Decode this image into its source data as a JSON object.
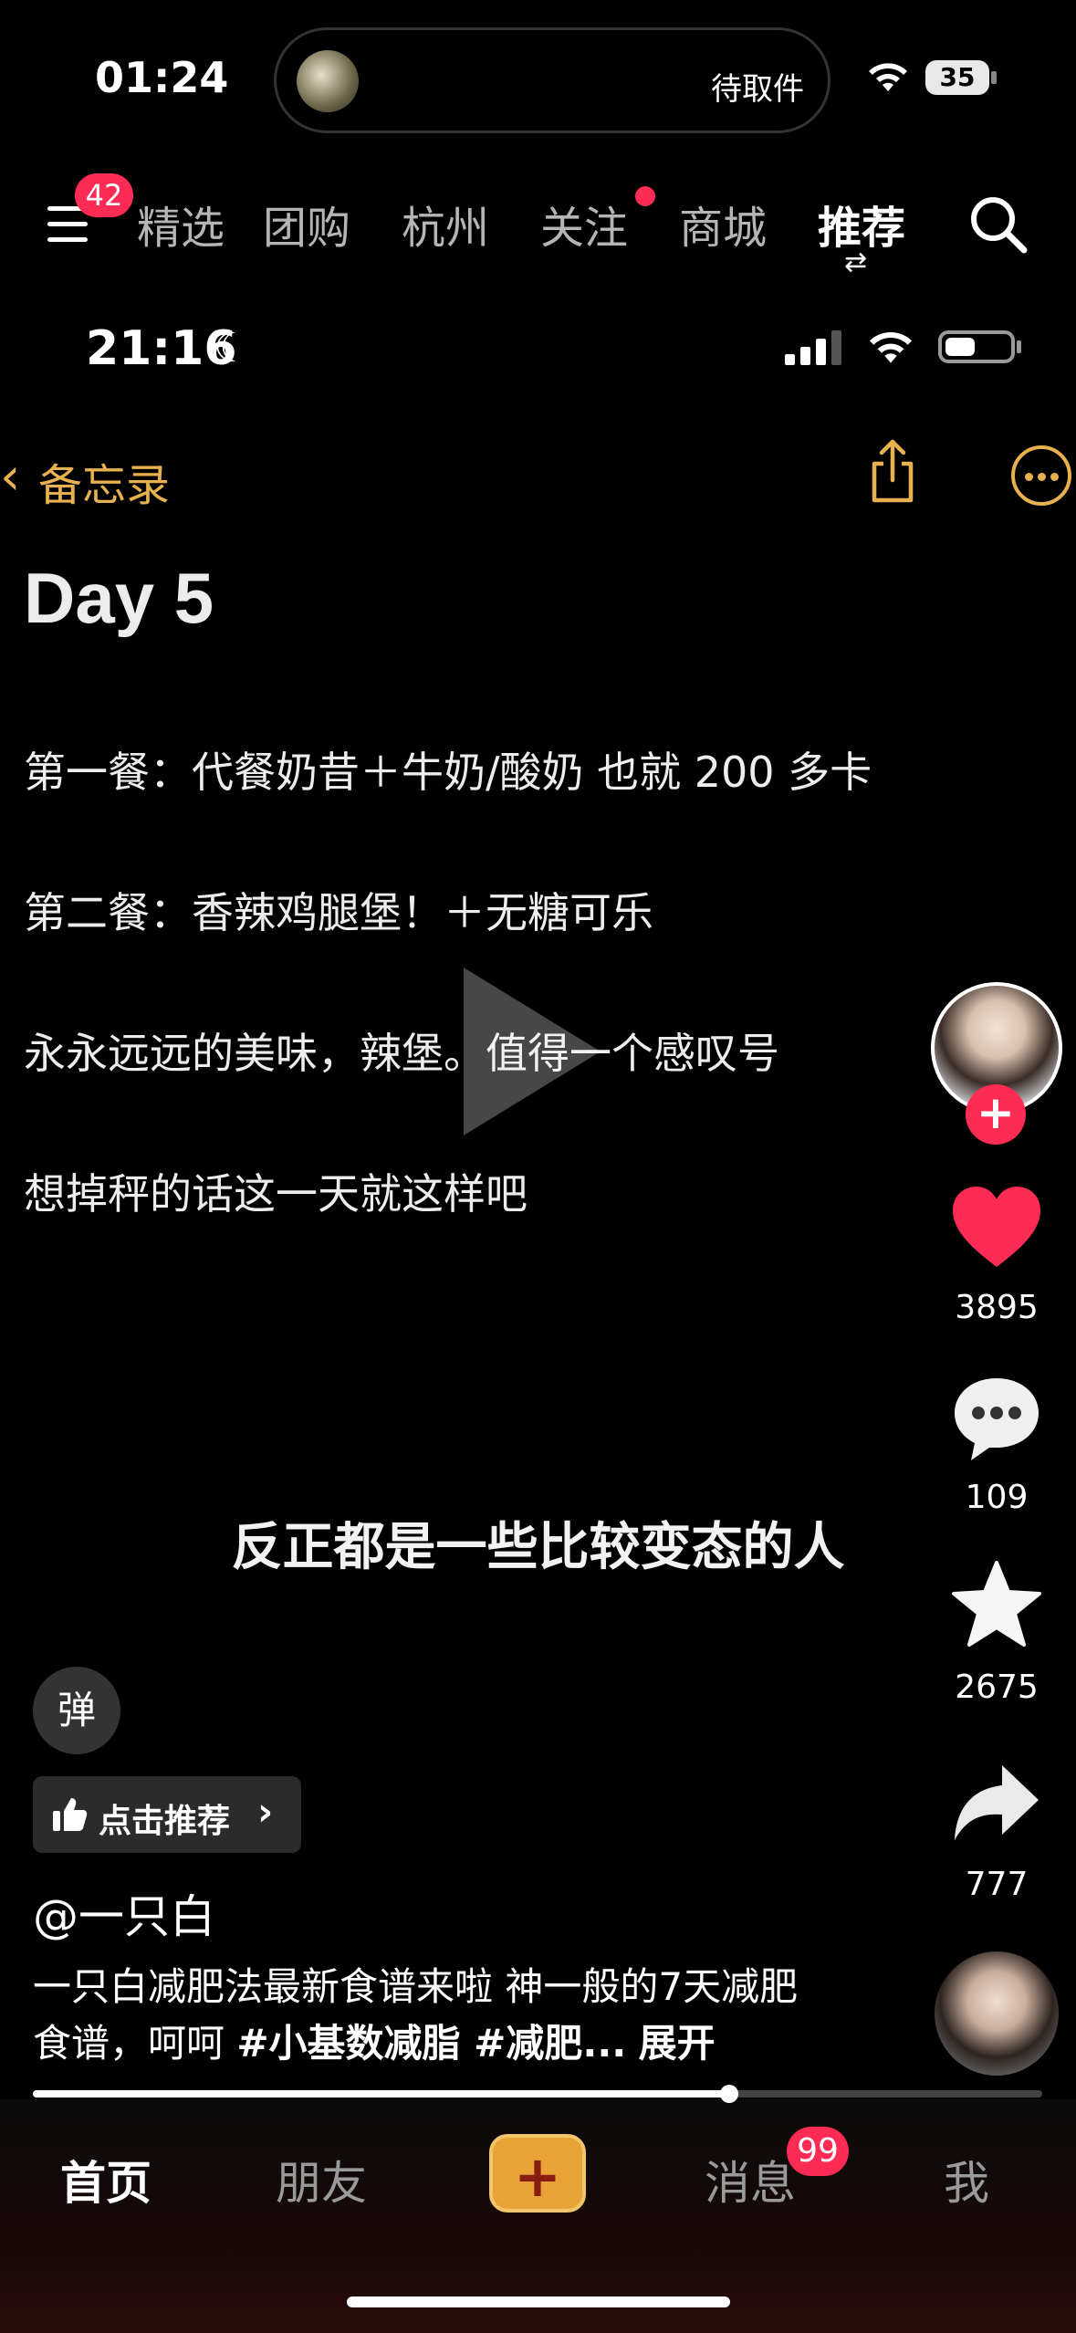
{
  "status_bar": {
    "time": "01:24",
    "island_text": "待取件",
    "battery": "35"
  },
  "top_nav": {
    "menu_badge": "42",
    "tabs": [
      {
        "label": "精选"
      },
      {
        "label": "团购"
      },
      {
        "label": "杭州"
      },
      {
        "label": "关注"
      },
      {
        "label": "商城"
      },
      {
        "label": "推荐"
      }
    ],
    "active_tab": "推荐"
  },
  "video": {
    "status_bar": {
      "time": "21:16"
    },
    "notes": {
      "back_label": "备忘录",
      "title": "Day 5",
      "lines": [
        "第一餐：代餐奶昔＋牛奶/酸奶 也就 200 多卡",
        "第二餐：香辣鸡腿堡！＋无糖可乐",
        "永永远远的美味，辣堡。值得一个感叹号",
        "想掉秤的话这一天就这样吧"
      ]
    },
    "subtitle": "反正都是一些比较变态的人",
    "progress": 0.69
  },
  "actions": {
    "likes": "3895",
    "comments": "109",
    "favorites": "2675",
    "shares": "777"
  },
  "info": {
    "danmu_label": "弹",
    "recommend_label": "点击推荐",
    "author": "@一只白",
    "caption_text": "一只白减肥法最新食谱来啦 神一般的7天减肥食谱，呵呵 ",
    "caption_tags": "#小基数减脂 #减肥...",
    "expand_label": "展开"
  },
  "bottom_tabs": {
    "home": "首页",
    "friends": "朋友",
    "create": "+",
    "messages": "消息",
    "messages_badge": "99",
    "me": "我"
  },
  "colors": {
    "accent_red": "#fe2c55",
    "notes_gold": "#e8b14f",
    "create_button": "#e8a237"
  }
}
